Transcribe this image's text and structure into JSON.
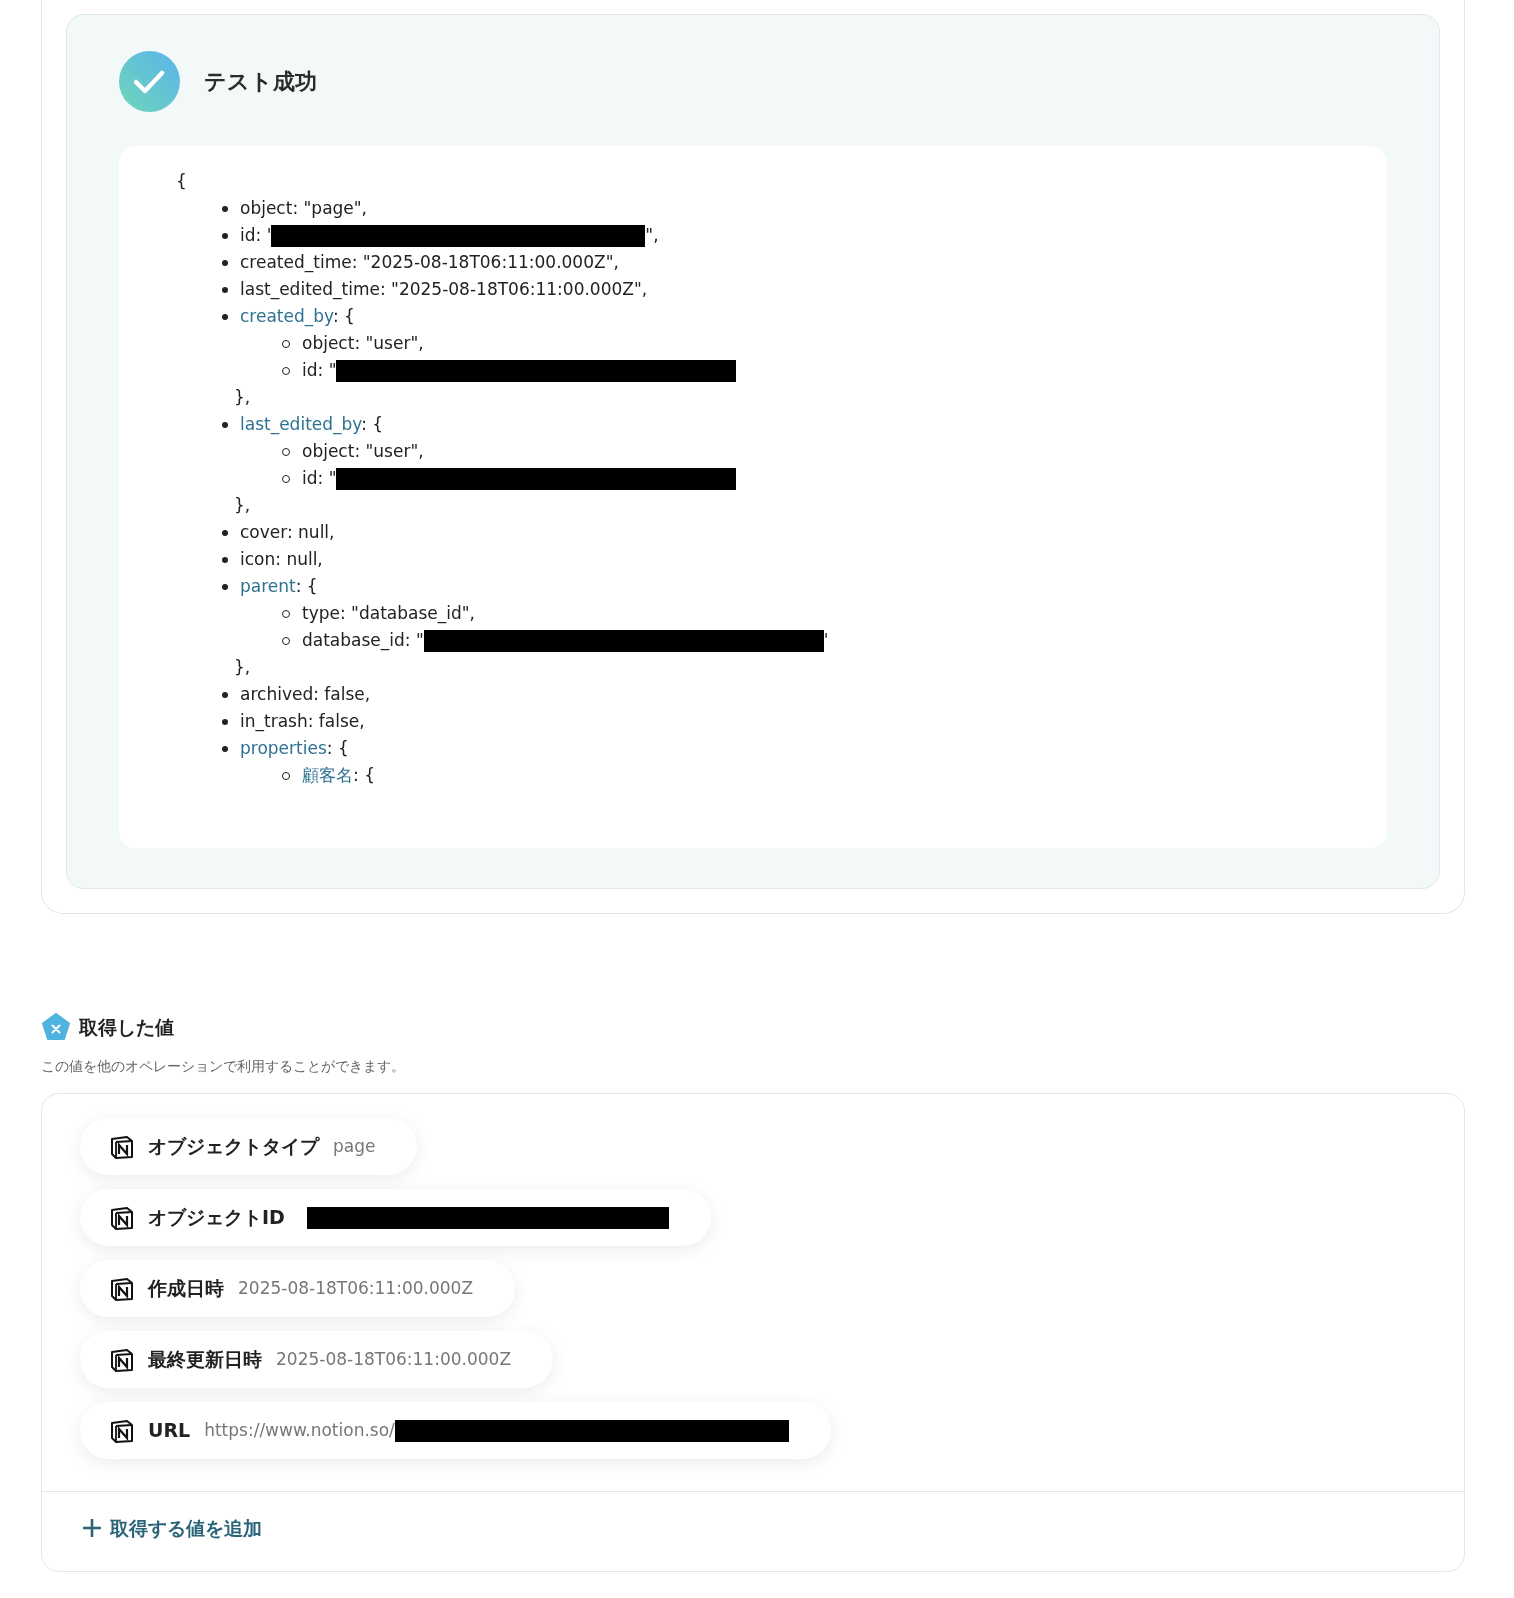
{
  "test_result": {
    "success": true,
    "title": "テスト成功",
    "code": {
      "open": "{",
      "items": [
        {
          "kind": "plain",
          "text": "object: \"page\","
        },
        {
          "kind": "redacted",
          "text": "id: '",
          "suffix": "\","
        },
        {
          "kind": "plain",
          "text": "created_time: \"2025-08-18T06:11:00.000Z\","
        },
        {
          "kind": "plain",
          "text": "last_edited_time: \"2025-08-18T06:11:00.000Z\","
        },
        {
          "kind": "object",
          "key": "created_by",
          "text": ": {",
          "close": "},",
          "children": [
            {
              "kind": "plain",
              "text": "object: \"user\","
            },
            {
              "kind": "redacted",
              "text": "id: \""
            }
          ]
        },
        {
          "kind": "object",
          "key": "last_edited_by",
          "text": ": {",
          "close": "},",
          "children": [
            {
              "kind": "plain",
              "text": "object: \"user\","
            },
            {
              "kind": "redacted",
              "text": "id: \""
            }
          ]
        },
        {
          "kind": "plain",
          "text": "cover: null,"
        },
        {
          "kind": "plain",
          "text": "icon: null,"
        },
        {
          "kind": "object",
          "key": "parent",
          "text": ": {",
          "close": "},",
          "children": [
            {
              "kind": "plain",
              "text": "type: \"database_id\","
            },
            {
              "kind": "redacted",
              "text": "database_id: \"",
              "suffix": "'"
            }
          ]
        },
        {
          "kind": "plain",
          "text": "archived: false,"
        },
        {
          "kind": "plain",
          "text": "in_trash: false,"
        },
        {
          "kind": "object",
          "key": "properties",
          "text": ": {",
          "children": [
            {
              "kind": "object",
              "key": "顧客名",
              "text": ": {"
            }
          ]
        }
      ]
    }
  },
  "values": {
    "title": "取得した値",
    "description": "この値を他のオペレーションで利用することができます。",
    "items": [
      {
        "label": "オブジェクトタイプ",
        "value": "page",
        "redacted": false
      },
      {
        "label": "オブジェクトID",
        "redacted": true
      },
      {
        "label": "作成日時",
        "value": "2025-08-18T06:11:00.000Z",
        "redacted": false
      },
      {
        "label": "最終更新日時",
        "value": "2025-08-18T06:11:00.000Z",
        "redacted": false
      },
      {
        "label": "URL",
        "value": "https://www.notion.so/",
        "redacted": true
      }
    ],
    "add_label": "取得する値を追加"
  }
}
